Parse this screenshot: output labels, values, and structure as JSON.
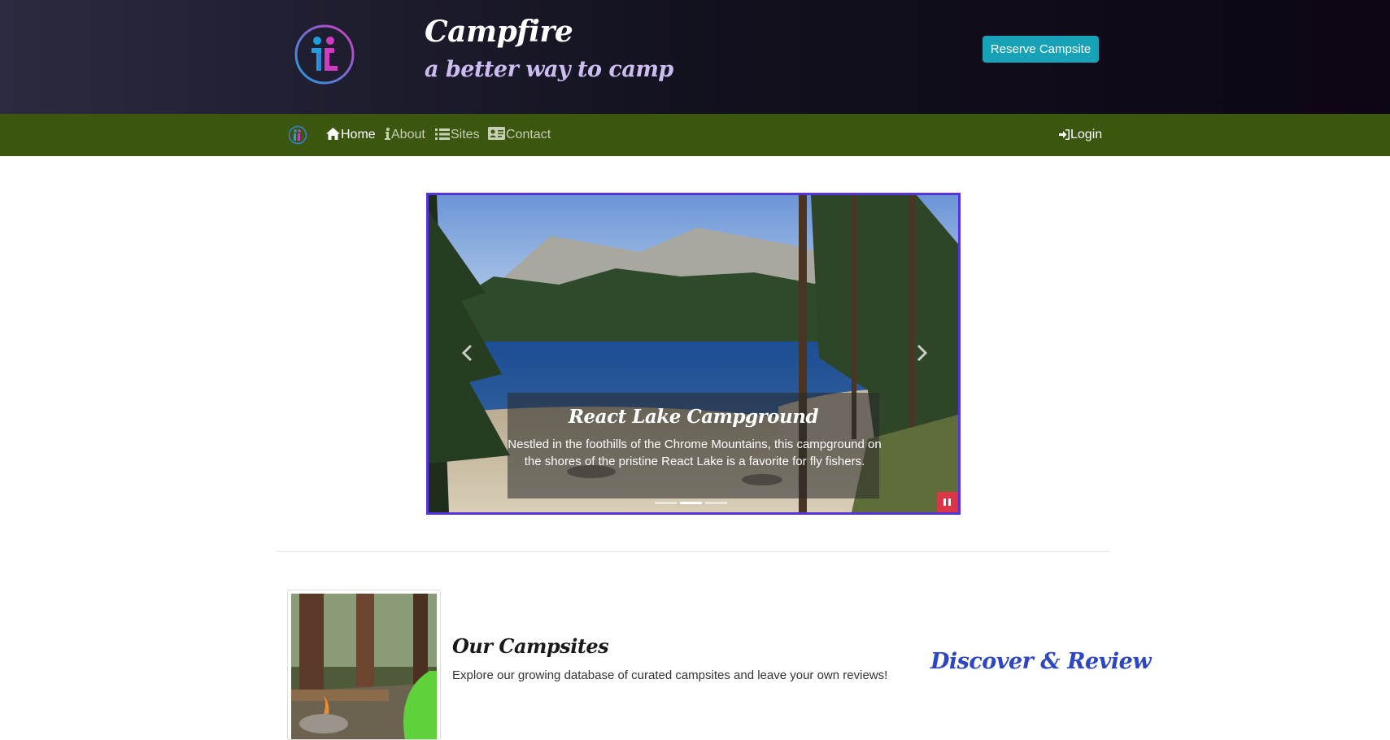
{
  "header": {
    "title": "Campfire",
    "tagline": "a better way to camp",
    "reserve_label": "Reserve Campsite",
    "logo_icon": "campfire-logo-icon"
  },
  "nav": {
    "items": [
      {
        "label": "Home",
        "icon": "home-icon",
        "active": true
      },
      {
        "label": "About",
        "icon": "info-icon",
        "active": false
      },
      {
        "label": "Sites",
        "icon": "list-icon",
        "active": false
      },
      {
        "label": "Contact",
        "icon": "address-card-icon",
        "active": false
      }
    ],
    "login_label": "Login",
    "login_icon": "sign-in-icon"
  },
  "carousel": {
    "slide_title": "React Lake Campground",
    "slide_text": "Nestled in the foothills of the Chrome Mountains, this campground on the shores of the pristine React Lake is a favorite for fly fishers.",
    "slide_count": 3,
    "active_slide": 2
  },
  "campsites": {
    "heading": "Our Campsites",
    "description": "Explore our growing database of curated campsites and leave your own reviews!",
    "tagline": "Discover & Review"
  },
  "colors": {
    "header_bg": "#1a1928",
    "nav_bg": "#3b560f",
    "accent_button": "#17a2b8",
    "tagline_purple": "#cdbcf2",
    "carousel_border": "#5533dd",
    "pause_button": "#dc3545",
    "discover_blue": "#2c46c4"
  }
}
